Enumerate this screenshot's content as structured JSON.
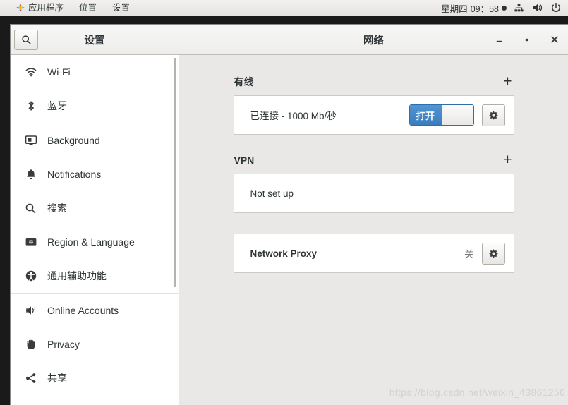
{
  "topbar": {
    "menus": [
      {
        "label": "应用程序",
        "icon": "applications-logo-icon"
      },
      {
        "label": "位置",
        "icon": null
      },
      {
        "label": "设置",
        "icon": null
      }
    ],
    "clock": {
      "day": "星期四",
      "time": "09：58"
    },
    "tray": [
      "network-wired-icon",
      "volume-icon",
      "power-icon"
    ]
  },
  "window": {
    "sidebar_title": "设置",
    "title": "网络",
    "controls": {
      "minimize": "minimize-icon",
      "maximize": "maximize-icon",
      "close": "close-icon"
    },
    "search_icon": "search-icon"
  },
  "sidebar": {
    "groups": [
      {
        "items": [
          {
            "label": "Wi-Fi",
            "icon": "wifi-icon"
          },
          {
            "label": "蓝牙",
            "icon": "bluetooth-icon"
          }
        ]
      },
      {
        "items": [
          {
            "label": "Background",
            "icon": "monitor-background-icon"
          },
          {
            "label": "Notifications",
            "icon": "bell-icon"
          },
          {
            "label": "搜索",
            "icon": "search-icon"
          },
          {
            "label": "Region & Language",
            "icon": "globe-language-icon"
          },
          {
            "label": "通用辅助功能",
            "icon": "accessibility-icon"
          }
        ]
      },
      {
        "items": [
          {
            "label": "Online Accounts",
            "icon": "online-accounts-icon"
          },
          {
            "label": "Privacy",
            "icon": "hand-privacy-icon"
          },
          {
            "label": "共享",
            "icon": "share-icon"
          }
        ]
      }
    ]
  },
  "main": {
    "sections": [
      {
        "title": "有线",
        "add_label": "+",
        "rows": [
          {
            "label": "已连接 - 1000 Mb/秒",
            "toggle": {
              "state_label": "打开",
              "on": true
            },
            "gear": "gear-icon"
          }
        ]
      },
      {
        "title": "VPN",
        "add_label": "+",
        "rows": [
          {
            "label": "Not set up"
          }
        ]
      }
    ],
    "proxy": {
      "label": "Network Proxy",
      "state": "关",
      "gear": "gear-icon"
    }
  },
  "watermark": "https://blog.csdn.net/weixin_43861256",
  "colors": {
    "accent_blue": "#3a7cbd",
    "panel_bg": "#e9e8e7",
    "card_bg": "#ffffff",
    "text": "#2e3436"
  }
}
